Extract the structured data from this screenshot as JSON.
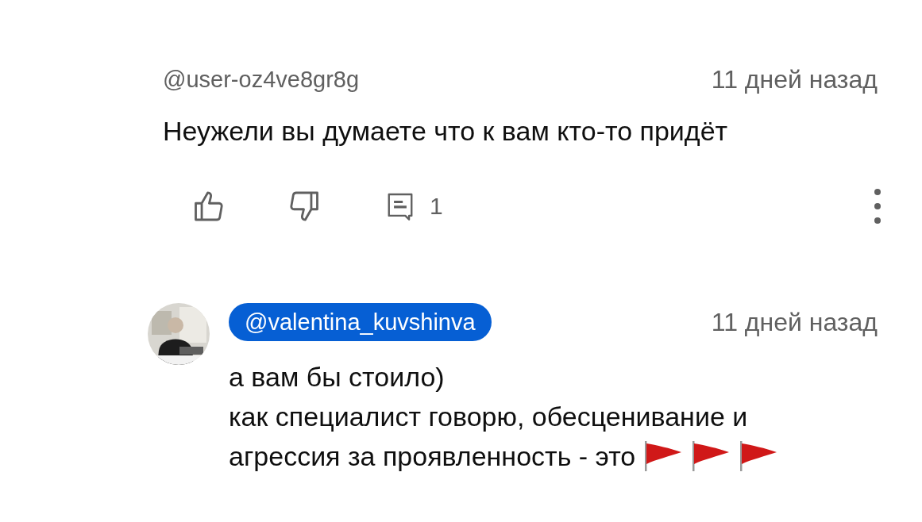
{
  "comments": [
    {
      "author": "@user-oz4ve8gr8g",
      "highlighted": false,
      "time": "11 дней назад",
      "lines": [
        {
          "kind": "plain",
          "text": "Неужели вы думаете что к вам кто-то придёт"
        }
      ],
      "reply_count": "1"
    },
    {
      "author": "@valentina_kuvshinva",
      "highlighted": true,
      "time": "11 дней назад",
      "lines": [
        {
          "kind": "plain",
          "text": "а вам бы стоило)"
        },
        {
          "kind": "plain",
          "text": "как специалист говорю, обесценивание и"
        },
        {
          "kind": "flags",
          "text": "агрессия за проявленность - это"
        }
      ]
    }
  ]
}
